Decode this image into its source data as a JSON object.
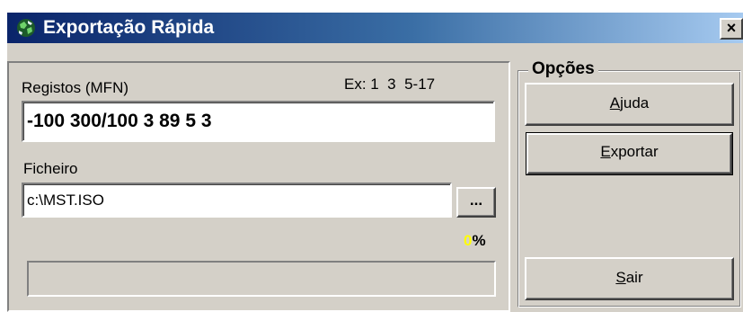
{
  "window": {
    "title": "Exportação Rápida",
    "close_glyph": "×",
    "icon": "globe-app-icon"
  },
  "records": {
    "label": "Registos (MFN)",
    "example": "Ex: 1  3  5-17",
    "value": "-100 300/100 3 89 5 3"
  },
  "file": {
    "label": "Ficheiro",
    "value": "c:\\MST.ISO",
    "browse_label": "..."
  },
  "progress": {
    "value": "0",
    "unit": "%",
    "fraction": 0
  },
  "options": {
    "title": "Opções",
    "help_accel": "A",
    "help_rest": "juda",
    "export_accel": "E",
    "export_rest": "xportar",
    "exit_accel": "S",
    "exit_rest": "air"
  },
  "colors": {
    "titlebar_start": "#0a246a",
    "titlebar_end": "#a6caf0",
    "dialog_face": "#d4d0c8",
    "percent_digit": "#ffff00"
  }
}
